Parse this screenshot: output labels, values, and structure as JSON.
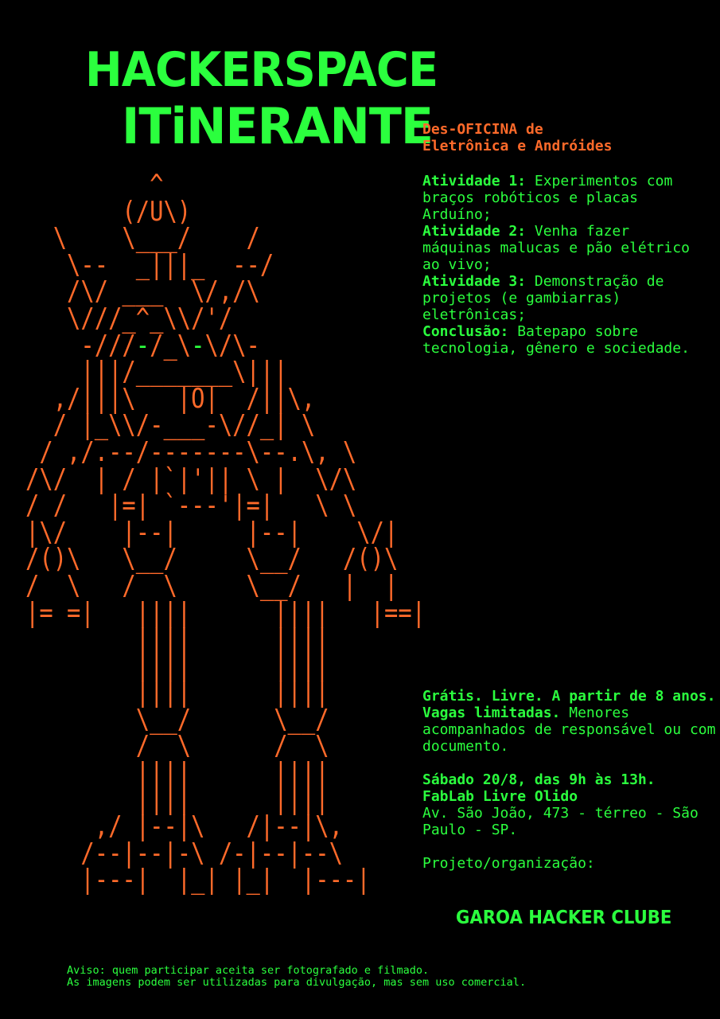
{
  "title": {
    "line1": "HACKERSPACE",
    "line2": "ITiNERANTE"
  },
  "subtitle": "Des-OFICINA de\nEletrônica e Andróides",
  "activities": [
    {
      "label": "Atividade 1:",
      "text": " Experimentos com braços robóticos e placas Arduíno;"
    },
    {
      "label": "Atividade 2:",
      "text": " Venha fazer máquinas malucas e pão elétrico ao vivo;"
    },
    {
      "label": "Atividade 3:",
      "text": " Demonstração de projetos (e gambiarras) eletrônicas;"
    },
    {
      "label": "Conclusão:",
      "text": " Batepapo sobre tecnologia, gênero e sociedade."
    }
  ],
  "info": {
    "free_bold": "Grátis. Livre. A partir de 8 anos. Vagas limitadas.",
    "free_text": "Menores acompanhados de responsável ou com documento.",
    "date_bold": "Sábado 20/8, das 9h às 13h.",
    "venue_bold": "FabLab Livre Olido",
    "address": "Av. São João, 473 - térreo - São Paulo - SP.",
    "organization_label": "Projeto/organização:"
  },
  "organization": "GAROA HACKER CLUBE",
  "notice": {
    "line1": "Aviso: quem participar aceita ser fotografado e filmado.",
    "line2": "As imagens podem ser utilizadas para divulgação, mas sem uso comercial."
  },
  "colors": {
    "background": "#000000",
    "green": "#2bff3e",
    "orange": "#ff6a2a"
  },
  "robot_ascii": {
    "r1": "         ^",
    "r2": "       (/U\\)",
    "r3": "  \\    \\___/    /",
    "r4": "   \\--  _|||_  --/",
    "r5": "   /\\/ ___  \\/,/\\",
    "r6": "   \\///_^_\\\\/'/",
    "r7a": "    -///",
    "r7b": "-",
    "r7c": "/_\\",
    "r7d": "-",
    "r7e": "\\/\\-",
    "r8": "    |||/_______\\|||",
    "r9": "  ,/|||\\   |O|  /||\\,",
    "r10": "  / |_\\\\/-___-\\//_| \\",
    "r11": " / ,/.--/-------\\--.\\, \\",
    "r12": "/\\/  | / |`|'|| \\ |  \\/\\",
    "r13": "/ /   |=| `---'|=|   \\ \\",
    "r14": "|\\/    |--|     |--|    \\/|",
    "r15": "/()\\   \\__/     \\__/   /()\\",
    "r16": "/  \\   /  \\     \\__/   |  |",
    "r17": "|= =|   ||||      ||||   |==|",
    "r18": "        ||||      ||||",
    "r19": "        ||||      ||||",
    "r20": "        ||||      ||||",
    "r21": "        \\__/      \\__/",
    "r22": "        /  \\      /  \\",
    "r23": "        ||||      ||||",
    "r24": "        ||||      ||||",
    "r25": "     ,/ |--|\\   /|--|\\,",
    "r26": "    /--|--|-\\ /-|--|--\\",
    "r27": "    |---|  |_| |_|  |---|"
  }
}
